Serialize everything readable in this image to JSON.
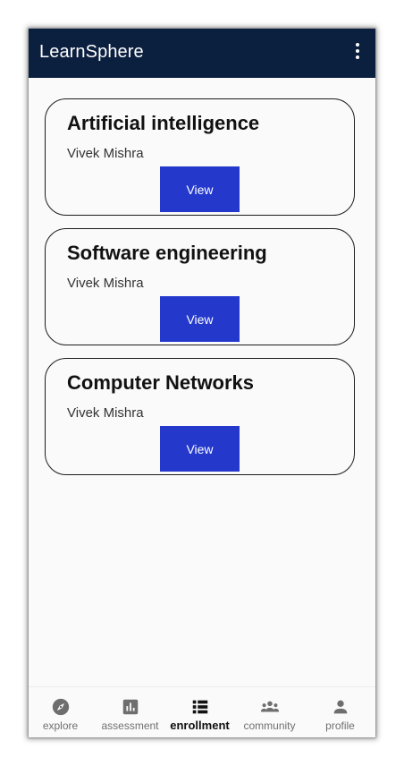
{
  "appbar": {
    "title": "LearnSphere",
    "menu_icon": "more-vert-icon"
  },
  "courses": [
    {
      "title": "Artificial intelligence",
      "author": "Vivek Mishra",
      "button_label": "View"
    },
    {
      "title": "Software engineering",
      "author": "Vivek Mishra",
      "button_label": "View"
    },
    {
      "title": "Computer Networks",
      "author": "Vivek Mishra",
      "button_label": "View"
    }
  ],
  "bottom_nav": {
    "active": "enrollment",
    "items": [
      {
        "label": "explore",
        "icon": "compass-icon"
      },
      {
        "label": "assessment",
        "icon": "bar-chart-icon"
      },
      {
        "label": "enrollment",
        "icon": "list-icon"
      },
      {
        "label": "community",
        "icon": "group-icon"
      },
      {
        "label": "profile",
        "icon": "person-icon"
      }
    ]
  },
  "colors": {
    "appbar_bg": "#0b1f3f",
    "button_bg": "#2438cc",
    "background": "#fafafa",
    "nav_inactive": "#707070",
    "nav_active": "#111111"
  }
}
